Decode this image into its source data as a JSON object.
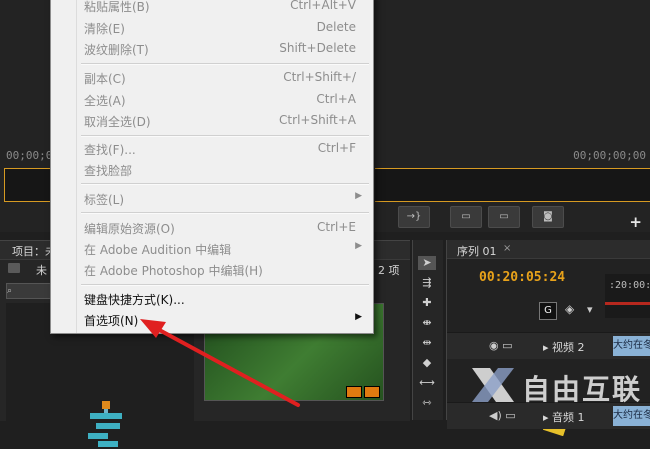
{
  "monitor": {
    "timecode_left": "00;00;0",
    "timecode_right": "00;00;00;00",
    "add_button": "+"
  },
  "project_panel": {
    "tab_label": "项目：未",
    "name": "未",
    "item_count": "2 项",
    "search_placeholder": "⌕"
  },
  "sequence_panel": {
    "tab_label": "序列 01",
    "close": "×",
    "timecode": "00:20:05:24",
    "ruler_timecode": ":20:00:0",
    "tracks": [
      {
        "label": "视频 2",
        "clip": "大约在冬季"
      },
      {
        "label": "音频 1",
        "clip": "大约在冬季"
      }
    ]
  },
  "context_menu": {
    "items": [
      {
        "label": "粘贴属性(B)",
        "shortcut": "Ctrl+Alt+V",
        "enabled": false
      },
      {
        "label": "清除(E)",
        "shortcut": "Delete",
        "enabled": false
      },
      {
        "label": "波纹删除(T)",
        "shortcut": "Shift+Delete",
        "enabled": false
      },
      {
        "label": "副本(C)",
        "shortcut": "Ctrl+Shift+/",
        "enabled": false
      },
      {
        "label": "全选(A)",
        "shortcut": "Ctrl+A",
        "enabled": false
      },
      {
        "label": "取消全选(D)",
        "shortcut": "Ctrl+Shift+A",
        "enabled": false
      },
      {
        "label": "查找(F)...",
        "shortcut": "Ctrl+F",
        "enabled": false
      },
      {
        "label": "查找脸部",
        "shortcut": "",
        "enabled": false
      },
      {
        "label": "标签(L)",
        "shortcut": "",
        "enabled": false,
        "submenu": true
      },
      {
        "label": "编辑原始资源(O)",
        "shortcut": "Ctrl+E",
        "enabled": false
      },
      {
        "label": "在 Adobe Audition 中编辑",
        "shortcut": "",
        "enabled": false,
        "submenu": true
      },
      {
        "label": "在 Adobe Photoshop 中编辑(H)",
        "shortcut": "",
        "enabled": false
      },
      {
        "label": "键盘快捷方式(K)...",
        "shortcut": "",
        "enabled": true
      },
      {
        "label": "首选项(N)",
        "shortcut": "",
        "enabled": true,
        "submenu": true
      }
    ]
  },
  "watermark": {
    "text": "自由互联"
  },
  "colors": {
    "timecode_accent": "#e8a21a",
    "annotation_arrow": "#e02020",
    "menu_background": "#f0f0f0"
  }
}
